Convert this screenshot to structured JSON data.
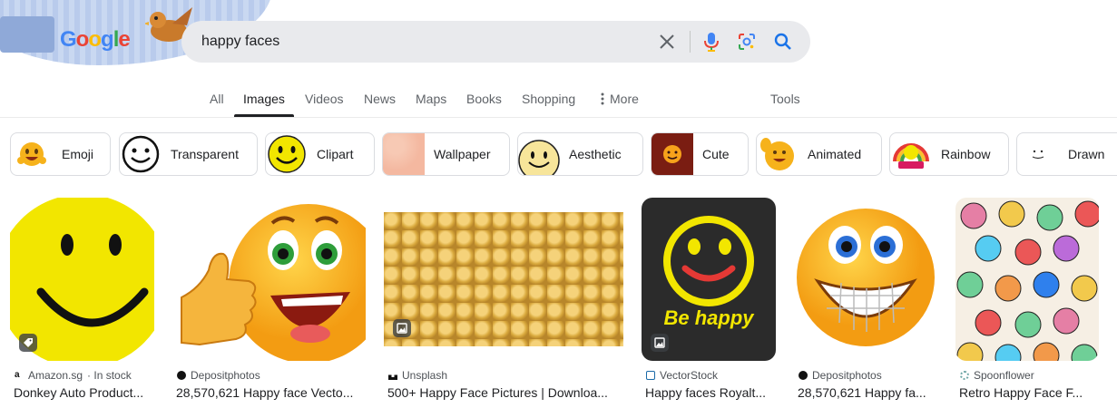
{
  "doodle": {
    "letters": [
      "G",
      "o",
      "o",
      "g",
      "l",
      "e"
    ]
  },
  "search": {
    "query": "happy faces"
  },
  "icons": {
    "clear": "close-icon",
    "voice": "microphone-icon",
    "lens": "camera-lens-icon",
    "search": "search-icon",
    "more": "three-dots-vertical-icon"
  },
  "tabs": [
    {
      "label": "All"
    },
    {
      "label": "Images"
    },
    {
      "label": "Videos"
    },
    {
      "label": "News"
    },
    {
      "label": "Maps"
    },
    {
      "label": "Books"
    },
    {
      "label": "Shopping"
    },
    {
      "label": "More"
    }
  ],
  "tools_label": "Tools",
  "chips": [
    {
      "label": "Emoji"
    },
    {
      "label": "Transparent"
    },
    {
      "label": "Clipart"
    },
    {
      "label": "Wallpaper"
    },
    {
      "label": "Aesthetic"
    },
    {
      "label": "Cute"
    },
    {
      "label": "Animated"
    },
    {
      "label": "Rainbow"
    },
    {
      "label": "Drawn"
    }
  ],
  "results": [
    {
      "source": "Amazon.sg",
      "source_extra": "· In stock",
      "title": "Donkey Auto Product..."
    },
    {
      "source": "Depositphotos",
      "source_extra": "",
      "title": "28,570,621 Happy face Vecto..."
    },
    {
      "source": "Unsplash",
      "source_extra": "",
      "title": "500+ Happy Face Pictures | Downloa..."
    },
    {
      "source": "VectorStock",
      "source_extra": "",
      "title": "Happy faces Royalt...",
      "image_text": "Be happy"
    },
    {
      "source": "Depositphotos",
      "source_extra": "",
      "title": "28,570,621 Happy fa..."
    },
    {
      "source": "Spoonflower",
      "source_extra": "",
      "title": "Retro Happy Face F..."
    }
  ],
  "colors": {
    "accent_blue": "#1a73e8",
    "smiley_yellow": "#f2e600",
    "text_primary": "#202124",
    "text_secondary": "#5f6368"
  }
}
